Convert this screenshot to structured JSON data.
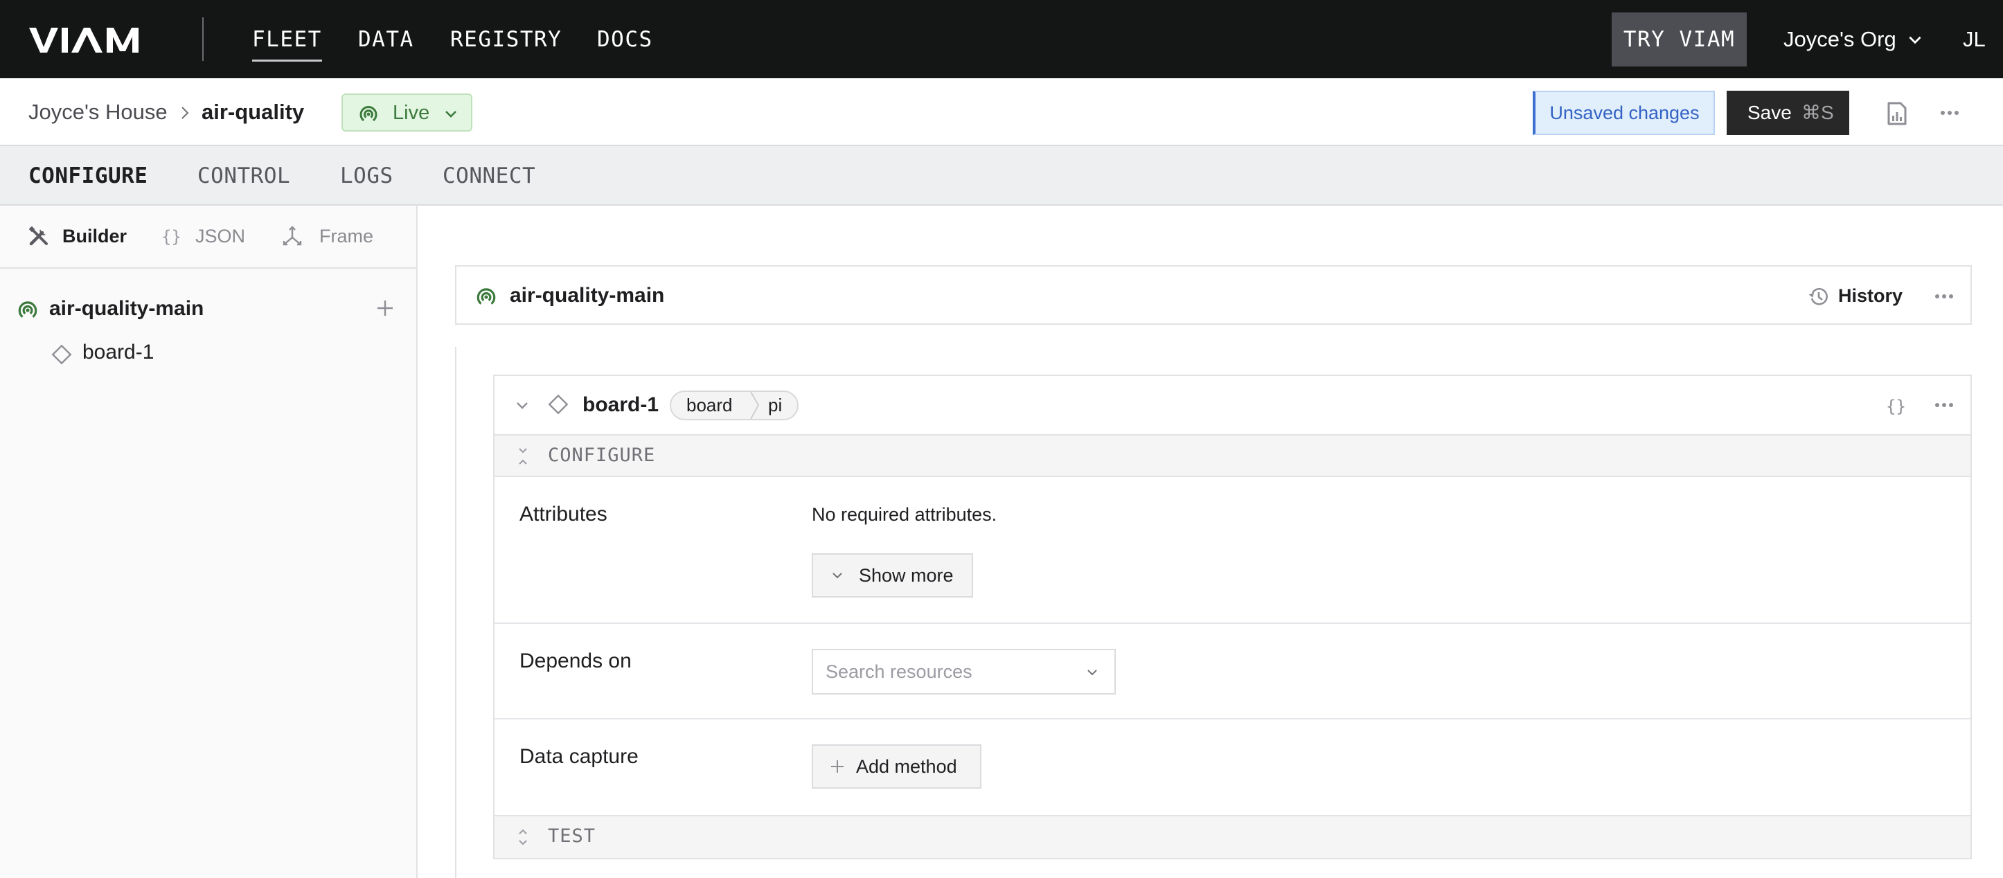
{
  "topbar": {
    "logo_text": "VIAM",
    "nav": [
      {
        "label": "FLEET",
        "active": true
      },
      {
        "label": "DATA",
        "active": false
      },
      {
        "label": "REGISTRY",
        "active": false
      },
      {
        "label": "DOCS",
        "active": false
      }
    ],
    "try_button": "TRY VIAM",
    "org_name": "Joyce's Org",
    "avatar_initials": "JL"
  },
  "header": {
    "breadcrumb": {
      "parent": "Joyce's House",
      "separator_icon": "chevron-right-icon",
      "current": "air-quality"
    },
    "status_badge": {
      "label": "Live",
      "icon": "broadcast-icon",
      "color": "#3c7a3d",
      "background": "#e3f6e1"
    },
    "unsaved_label": "Unsaved changes",
    "save_label": "Save",
    "save_shortcut": "⌘S",
    "report_icon": "usage-report-icon",
    "more_icon": "ellipsis-icon"
  },
  "tabs": [
    {
      "label": "CONFIGURE",
      "active": true
    },
    {
      "label": "CONTROL",
      "active": false
    },
    {
      "label": "LOGS",
      "active": false
    },
    {
      "label": "CONNECT",
      "active": false
    }
  ],
  "sidebar": {
    "modes": [
      {
        "label": "Builder",
        "icon": "tools-icon",
        "active": true
      },
      {
        "label": "JSON",
        "icon": "braces-icon",
        "active": false
      },
      {
        "label": "Frame",
        "icon": "axes-icon",
        "active": false
      }
    ],
    "tree": {
      "root": {
        "label": "air-quality-main",
        "icon": "broadcast-icon"
      },
      "children": [
        {
          "label": "board-1",
          "icon": "diamond-icon"
        }
      ]
    }
  },
  "main": {
    "machine_card": {
      "name": "air-quality-main",
      "history_label": "History"
    },
    "component": {
      "name": "board-1",
      "type": "board",
      "model": "pi",
      "configure_label": "CONFIGURE",
      "test_label": "TEST",
      "rows": {
        "attributes": {
          "label": "Attributes",
          "text": "No required attributes.",
          "button": "Show more"
        },
        "depends_on": {
          "label": "Depends on",
          "placeholder": "Search resources",
          "value": ""
        },
        "data_capture": {
          "label": "Data capture",
          "button": "Add method"
        }
      }
    }
  },
  "colors": {
    "topbar_bg": "#141616",
    "accent_green": "#3c7a3d",
    "unsaved_blue": "#3463c4",
    "save_bg": "#282828"
  }
}
